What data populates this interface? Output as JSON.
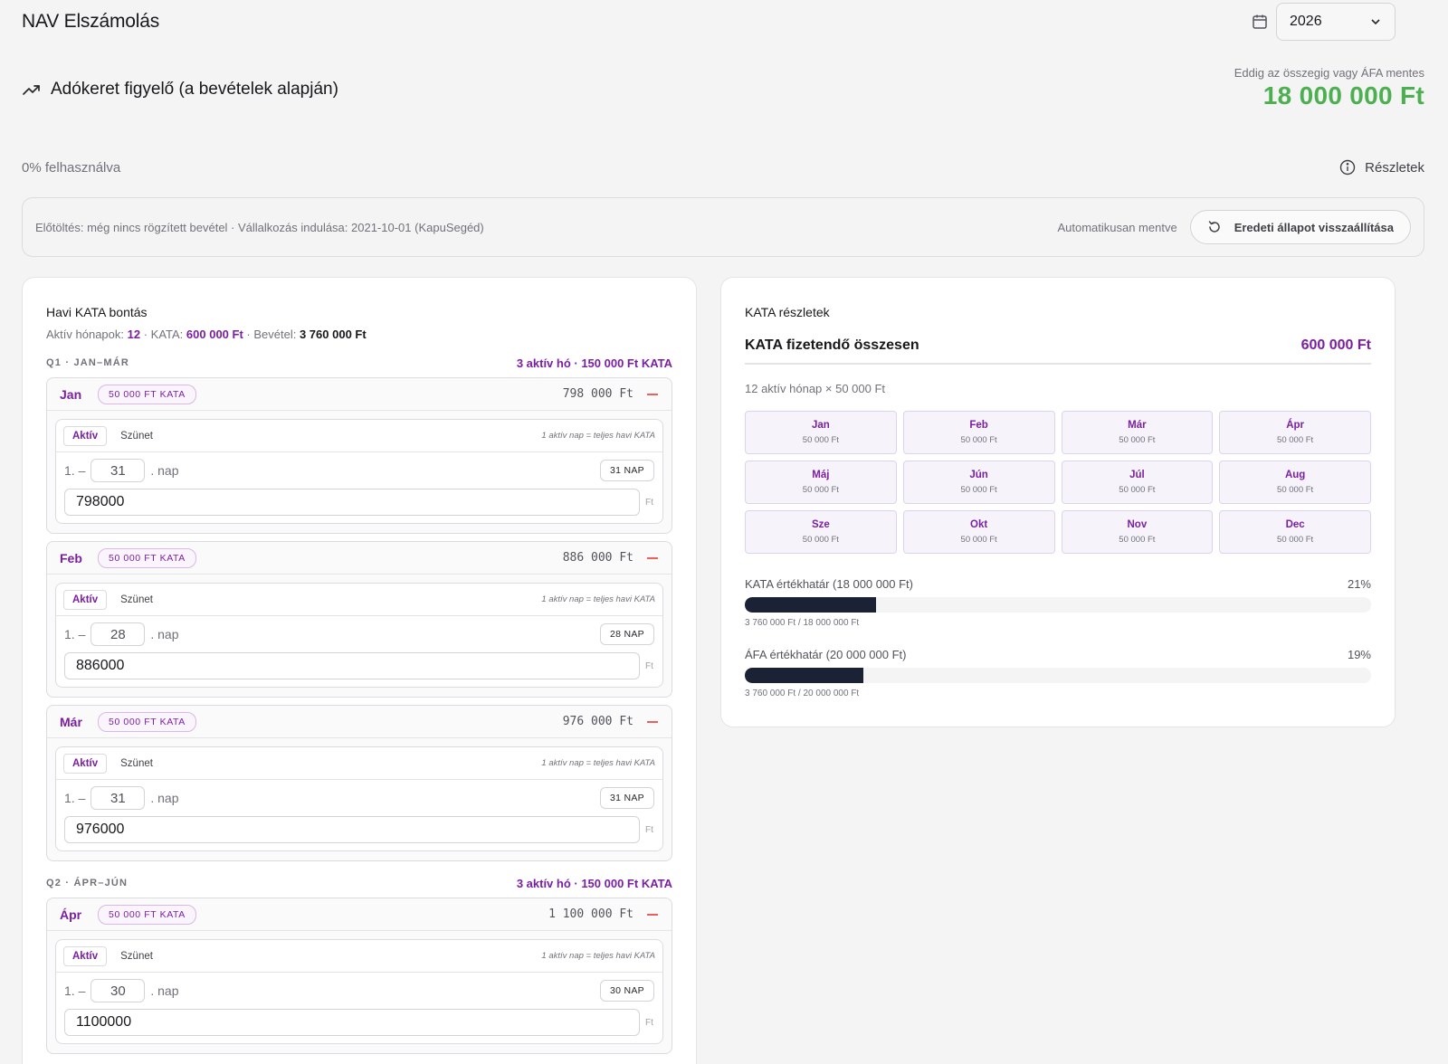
{
  "header": {
    "app_title": "NAV Elszámolás",
    "year": "2026",
    "icons": {
      "calendar": "calendar-icon",
      "chevron": "chevron-down-icon"
    }
  },
  "tracker": {
    "title": "Adókeret figyelő (a bevételek alapján)",
    "limit_caption": "Eddig az összegig vagy ÁFA mentes",
    "limit_value": "18 000 000 Ft",
    "usage_text": "0% felhasználva",
    "details_label": "Részletek"
  },
  "prefill": {
    "text": "Előtöltés: még nincs rögzített bevétel · Vállalkozás indulása: 2021-10-01 (KapuSegéd)",
    "autosave": "Automatikusan mentve",
    "reset_label": "Eredeti állapot visszaállítása"
  },
  "monthly": {
    "heading": "Havi KATA bontás",
    "summary": {
      "active_label": "Aktív hónapok:",
      "active_count": "12",
      "kata_label": " · KATA:",
      "kata_value": "600 000 Ft",
      "revenue_label": " · Bevétel:",
      "revenue_value": "3 760 000 Ft"
    },
    "common": {
      "tab_active": "Aktív",
      "tab_pause": "Szünet",
      "hint": "1 aktív nap = teljes havi KATA",
      "day_prefix": "1. –",
      "day_suffix": ". nap",
      "ft": "Ft"
    },
    "quarters": [
      {
        "label": "Q1 · JAN–MÁR",
        "summary": "3 aktív hó · 150 000 Ft KATA",
        "months": [
          {
            "name": "Jan",
            "pill": "50 000 FT KATA",
            "amount": "798 000 Ft",
            "days": "31",
            "badge": "31 NAP",
            "input": "798000"
          },
          {
            "name": "Feb",
            "pill": "50 000 FT KATA",
            "amount": "886 000 Ft",
            "days": "28",
            "badge": "28 NAP",
            "input": "886000"
          },
          {
            "name": "Már",
            "pill": "50 000 FT KATA",
            "amount": "976 000 Ft",
            "days": "31",
            "badge": "31 NAP",
            "input": "976000"
          }
        ]
      },
      {
        "label": "Q2 · ÁPR–JÚN",
        "summary": "3 aktív hó · 150 000 Ft KATA",
        "months": [
          {
            "name": "Ápr",
            "pill": "50 000 FT KATA",
            "amount": "1 100 000 Ft",
            "days": "30",
            "badge": "30 NAP",
            "input": "1100000"
          }
        ]
      }
    ]
  },
  "details": {
    "heading": "KATA részletek",
    "total_label": "KATA fizetendő összesen",
    "total_value": "600 000 Ft",
    "active_line": "12 aktív hónap × 50 000 Ft",
    "months": [
      {
        "name": "Jan",
        "amount": "50 000 Ft"
      },
      {
        "name": "Feb",
        "amount": "50 000 Ft"
      },
      {
        "name": "Már",
        "amount": "50 000 Ft"
      },
      {
        "name": "Ápr",
        "amount": "50 000 Ft"
      },
      {
        "name": "Máj",
        "amount": "50 000 Ft"
      },
      {
        "name": "Jún",
        "amount": "50 000 Ft"
      },
      {
        "name": "Júl",
        "amount": "50 000 Ft"
      },
      {
        "name": "Aug",
        "amount": "50 000 Ft"
      },
      {
        "name": "Sze",
        "amount": "50 000 Ft"
      },
      {
        "name": "Okt",
        "amount": "50 000 Ft"
      },
      {
        "name": "Nov",
        "amount": "50 000 Ft"
      },
      {
        "name": "Dec",
        "amount": "50 000 Ft"
      }
    ],
    "limits": [
      {
        "label": "KATA értékhatár (18 000 000 Ft)",
        "percent_label": "21%",
        "fill_fraction": 0.21,
        "sub": "3 760 000 Ft / 18 000 000 Ft"
      },
      {
        "label": "ÁFA értékhatár (20 000 000 Ft)",
        "percent_label": "19%",
        "fill_fraction": 0.19,
        "sub": "3 760 000 Ft / 20 000 000 Ft"
      }
    ]
  },
  "colors": {
    "accent": "#7b1fa2",
    "success": "#4caf50",
    "bar": "#1c2235",
    "remove": "#e53935"
  }
}
